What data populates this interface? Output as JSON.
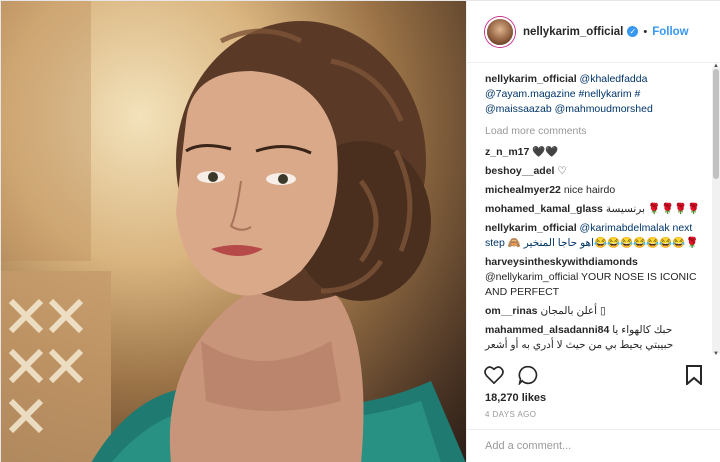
{
  "header": {
    "username": "nellykarim_official",
    "separator": "•",
    "follow_label": "Follow"
  },
  "caption": {
    "username": "nellykarim_official",
    "text": "@khaledfadda @7ayam.magazine #nellykarim # @maissaazab @mahmoudmorshed"
  },
  "load_more_label": "Load more comments",
  "comments": [
    {
      "user": "z_n_m17",
      "text": "🖤🖤"
    },
    {
      "user": "beshoy__adel",
      "text": "♡"
    },
    {
      "user": "michealmyer22",
      "text": "nice hairdo"
    },
    {
      "user": "mohamed_kamal_glass",
      "text": "برنسيسة 🌹🌹🌹🌹"
    },
    {
      "user": "nellykarim_official",
      "text": "@karimabdelmalak next step 🙈 اهو حاجا المنخير😂😂😂😂😂😂😂🌹"
    },
    {
      "user": "harveysintheskywithdiamonds",
      "text": "@nellykarim_official YOUR NOSE IS ICONIC AND PERFECT"
    },
    {
      "user": "om__rinas",
      "text": "أعلن بالمجان ▯"
    },
    {
      "user": "mahammed_alsadanni84",
      "text": "حبك كالهواء يا حبيبتي يحيط بي من حيث لا أدري به أو أشعر"
    }
  ],
  "likes": "18,270 likes",
  "timestamp": "4 DAYS AGO",
  "add_comment_placeholder": "Add a comment..."
}
